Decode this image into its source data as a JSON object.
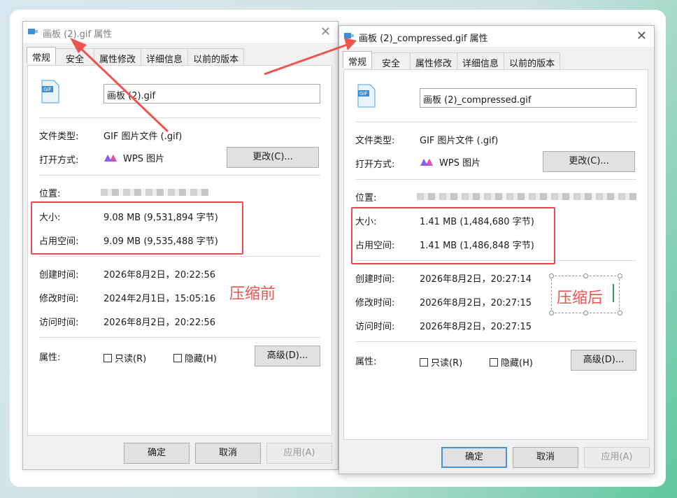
{
  "colors": {
    "annotation_red": "#ef5350",
    "box_red": "#e84c4c",
    "accent_blue": "#4a90d9",
    "dialog_bg": "#f0f0f0"
  },
  "left_dialog": {
    "title": "画板 (2).gif 属性",
    "tabs": [
      "常规",
      "安全",
      "属性修改",
      "详细信息",
      "以前的版本"
    ],
    "file_icon": "gif-file-icon",
    "filename": "画板 (2).gif",
    "file_type_label": "文件类型:",
    "file_type_value": "GIF 图片文件 (.gif)",
    "open_with_label": "打开方式:",
    "open_with_app": "WPS 图片",
    "change_button": "更改(C)...",
    "location_label": "位置:",
    "size_label": "大小:",
    "size_value": "9.08 MB (9,531,894 字节)",
    "disk_size_label": "占用空间:",
    "disk_size_value": "9.09 MB (9,535,488 字节)",
    "created_label": "创建时间:",
    "created_value": "2026年8月2日，20:22:56",
    "modified_label": "修改时间:",
    "modified_value": "2024年2月1日，15:05:16",
    "accessed_label": "访问时间:",
    "accessed_value": "2026年8月2日，20:22:56",
    "attributes_label": "属性:",
    "readonly_label": "只读(R)",
    "hidden_label": "隐藏(H)",
    "advanced_button": "高级(D)...",
    "ok_button": "确定",
    "cancel_button": "取消",
    "apply_button": "应用(A)"
  },
  "right_dialog": {
    "title": "画板 (2)_compressed.gif 属性",
    "tabs": [
      "常规",
      "安全",
      "属性修改",
      "详细信息",
      "以前的版本"
    ],
    "file_icon": "gif-file-icon",
    "filename": "画板 (2)_compressed.gif",
    "file_type_label": "文件类型:",
    "file_type_value": "GIF 图片文件 (.gif)",
    "open_with_label": "打开方式:",
    "open_with_app": "WPS 图片",
    "change_button": "更改(C)...",
    "location_label": "位置:",
    "size_label": "大小:",
    "size_value": "1.41 MB (1,484,680 字节)",
    "disk_size_label": "占用空间:",
    "disk_size_value": "1.41 MB (1,486,848 字节)",
    "created_label": "创建时间:",
    "created_value": "2026年8月2日，20:27:14",
    "modified_label": "修改时间:",
    "modified_value": "2026年8月2日，20:27:15",
    "accessed_label": "访问时间:",
    "accessed_value": "2026年8月2日，20:27:15",
    "attributes_label": "属性:",
    "readonly_label": "只读(R)",
    "hidden_label": "隐藏(H)",
    "advanced_button": "高级(D)...",
    "ok_button": "确定",
    "cancel_button": "取消",
    "apply_button": "应用(A)"
  },
  "annotations": {
    "before_label": "压缩前",
    "after_label": "压缩后"
  }
}
